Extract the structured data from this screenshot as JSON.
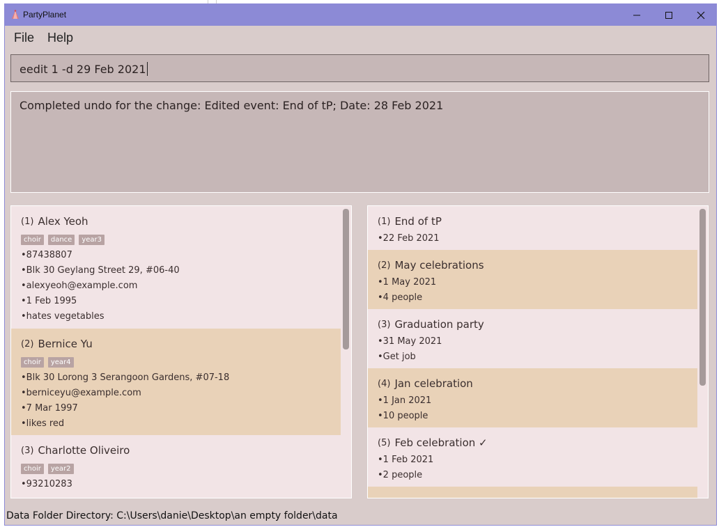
{
  "window": {
    "title": "PartyPlanet"
  },
  "menu": {
    "file": "File",
    "help": "Help"
  },
  "command": {
    "value": "eedit 1 -d 29 Feb 2021"
  },
  "result": {
    "text": "Completed undo for the change: Edited event: End of tP; Date: 28 Feb 2021"
  },
  "persons": [
    {
      "index": "1",
      "name": "Alex Yeoh",
      "tags": [
        "choir",
        "dance",
        "year3"
      ],
      "lines": [
        "•87438807",
        "•Blk 30 Geylang Street 29, #06-40",
        "•alexyeoh@example.com",
        "•1 Feb 1995",
        "•hates vegetables"
      ]
    },
    {
      "index": "2",
      "name": "Bernice Yu",
      "tags": [
        "choir",
        "year4"
      ],
      "lines": [
        "•Blk 30 Lorong 3 Serangoon Gardens, #07-18",
        "•berniceyu@example.com",
        "•7 Mar 1997",
        "•likes red"
      ]
    },
    {
      "index": "3",
      "name": "Charlotte Oliveiro",
      "tags": [
        "choir",
        "year2"
      ],
      "lines": [
        "•93210283"
      ]
    }
  ],
  "events": [
    {
      "index": "1",
      "name": "End of tP",
      "lines": [
        "•22 Feb 2021"
      ]
    },
    {
      "index": "2",
      "name": "May celebrations",
      "lines": [
        "•1 May 2021",
        "•4 people"
      ]
    },
    {
      "index": "3",
      "name": "Graduation party",
      "lines": [
        "•31 May 2021",
        "•Get job"
      ]
    },
    {
      "index": "4",
      "name": "Jan celebration",
      "lines": [
        "•1 Jan 2021",
        "•10 people"
      ]
    },
    {
      "index": "5",
      "name": "Feb celebration ✓",
      "lines": [
        "•1 Feb 2021",
        "•2 people"
      ]
    }
  ],
  "status": {
    "text": "Data Folder Directory: C:\\Users\\danie\\Desktop\\an empty folder\\data"
  },
  "colors": {
    "titlebar": "#8c8ad6",
    "background": "#d9cccb",
    "card": "#f2e4e6",
    "card_alt": "#e9d2b8",
    "tag": "#b8a3a3"
  }
}
